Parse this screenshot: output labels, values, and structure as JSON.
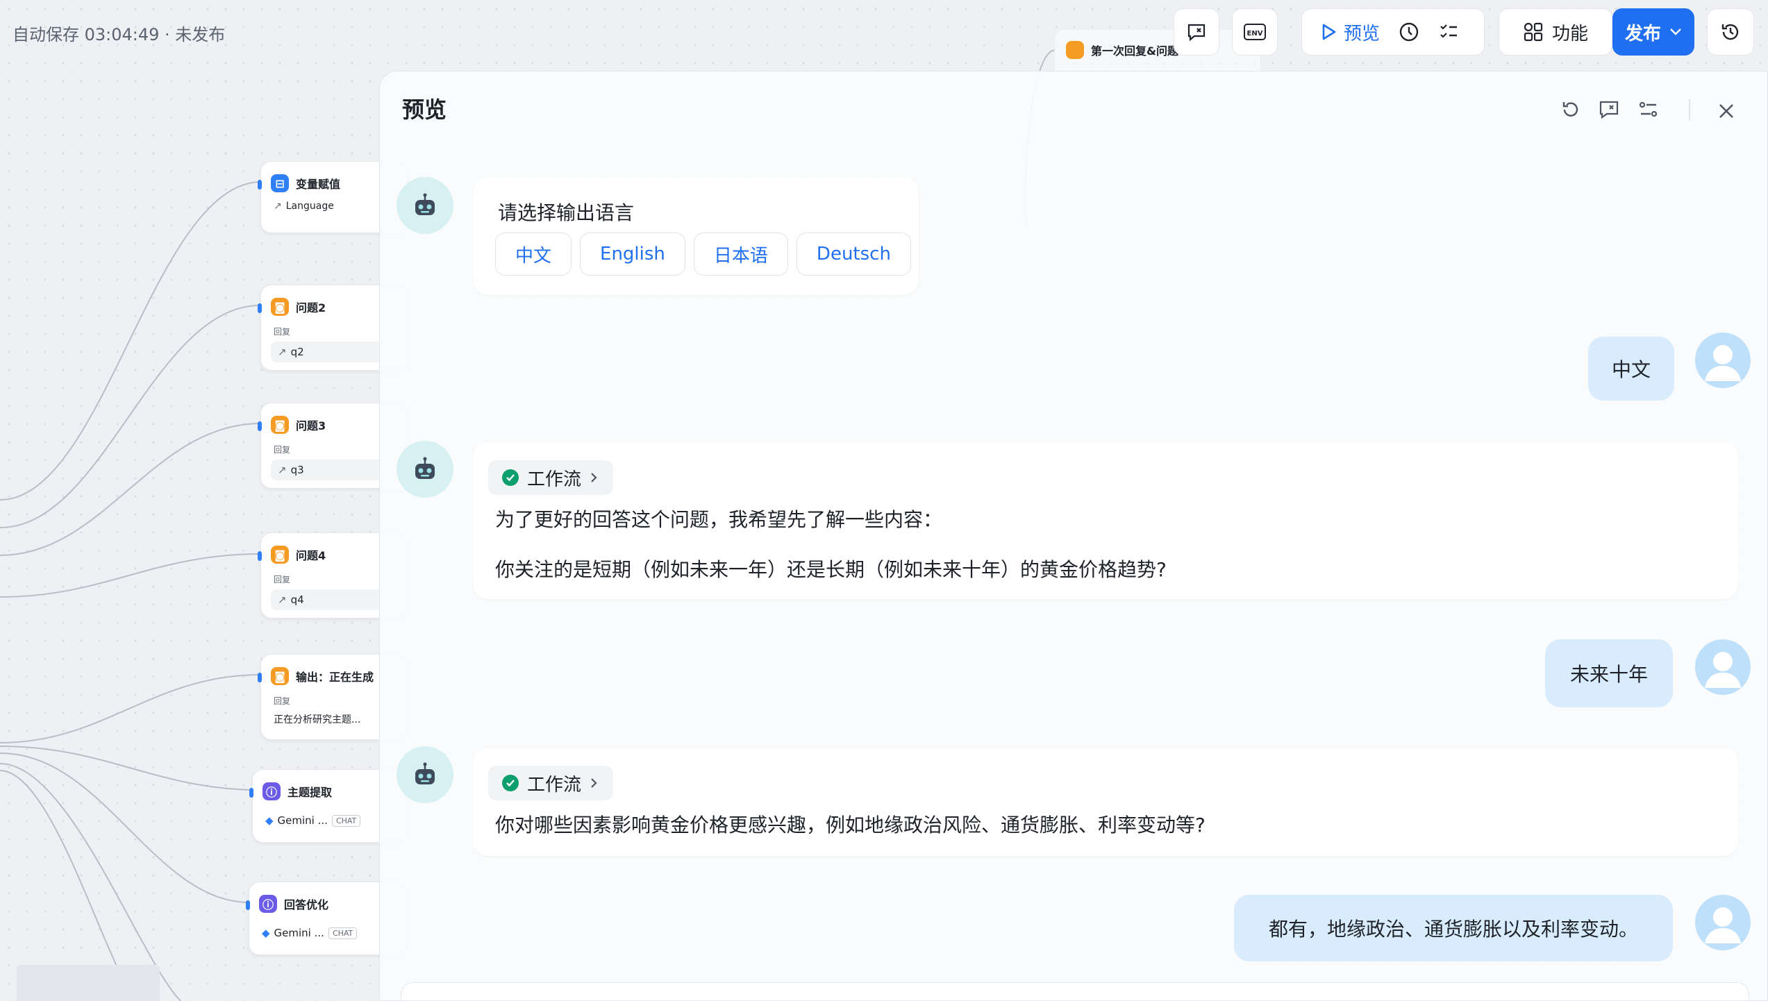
{
  "status": {
    "autosave": "自动保存 03:04:49 · 未发布"
  },
  "toolbar": {
    "preview_label": "预览",
    "features_label": "功能",
    "publish_label": "发布"
  },
  "nodes": [
    {
      "title": "变量赋值",
      "pill": "Language",
      "color": "blue"
    },
    {
      "title": "问题2",
      "sub": "回复",
      "pill": "q2",
      "color": "orange"
    },
    {
      "title": "问题3",
      "sub": "回复",
      "pill": "q3",
      "color": "orange"
    },
    {
      "title": "问题4",
      "sub": "回复",
      "pill": "q4",
      "color": "orange"
    },
    {
      "title": "输出：正在生成",
      "sub": "回复",
      "pill": "正在分析研究主题...",
      "color": "orange"
    },
    {
      "title": "主题提取",
      "pill": "Gemini ...",
      "chip": "CHAT",
      "color": "purple"
    },
    {
      "title": "回答优化",
      "pill": "Gemini ...",
      "chip": "CHAT",
      "color": "purple"
    }
  ],
  "top_node": {
    "title": "第一次回复&问题"
  },
  "panel": {
    "title": "预览",
    "messages": {
      "ask_language": "请选择输出语言",
      "options": [
        "中文",
        "English",
        "日本语",
        "Deutsch"
      ],
      "user1": "中文",
      "workflow_label": "工作流",
      "bot2_line1": "为了更好的回答这个问题，我希望先了解一些内容：",
      "bot2_line2": "你关注的是短期（例如未来一年）还是长期（例如未来十年）的黄金价格趋势?",
      "user2": "未来十年",
      "bot3_line1": "你对哪些因素影响黄金价格更感兴趣，例如地缘政治风险、通货膨胀、利率变动等?",
      "user3": "都有，地缘政治、通货膨胀以及利率变动。"
    }
  }
}
